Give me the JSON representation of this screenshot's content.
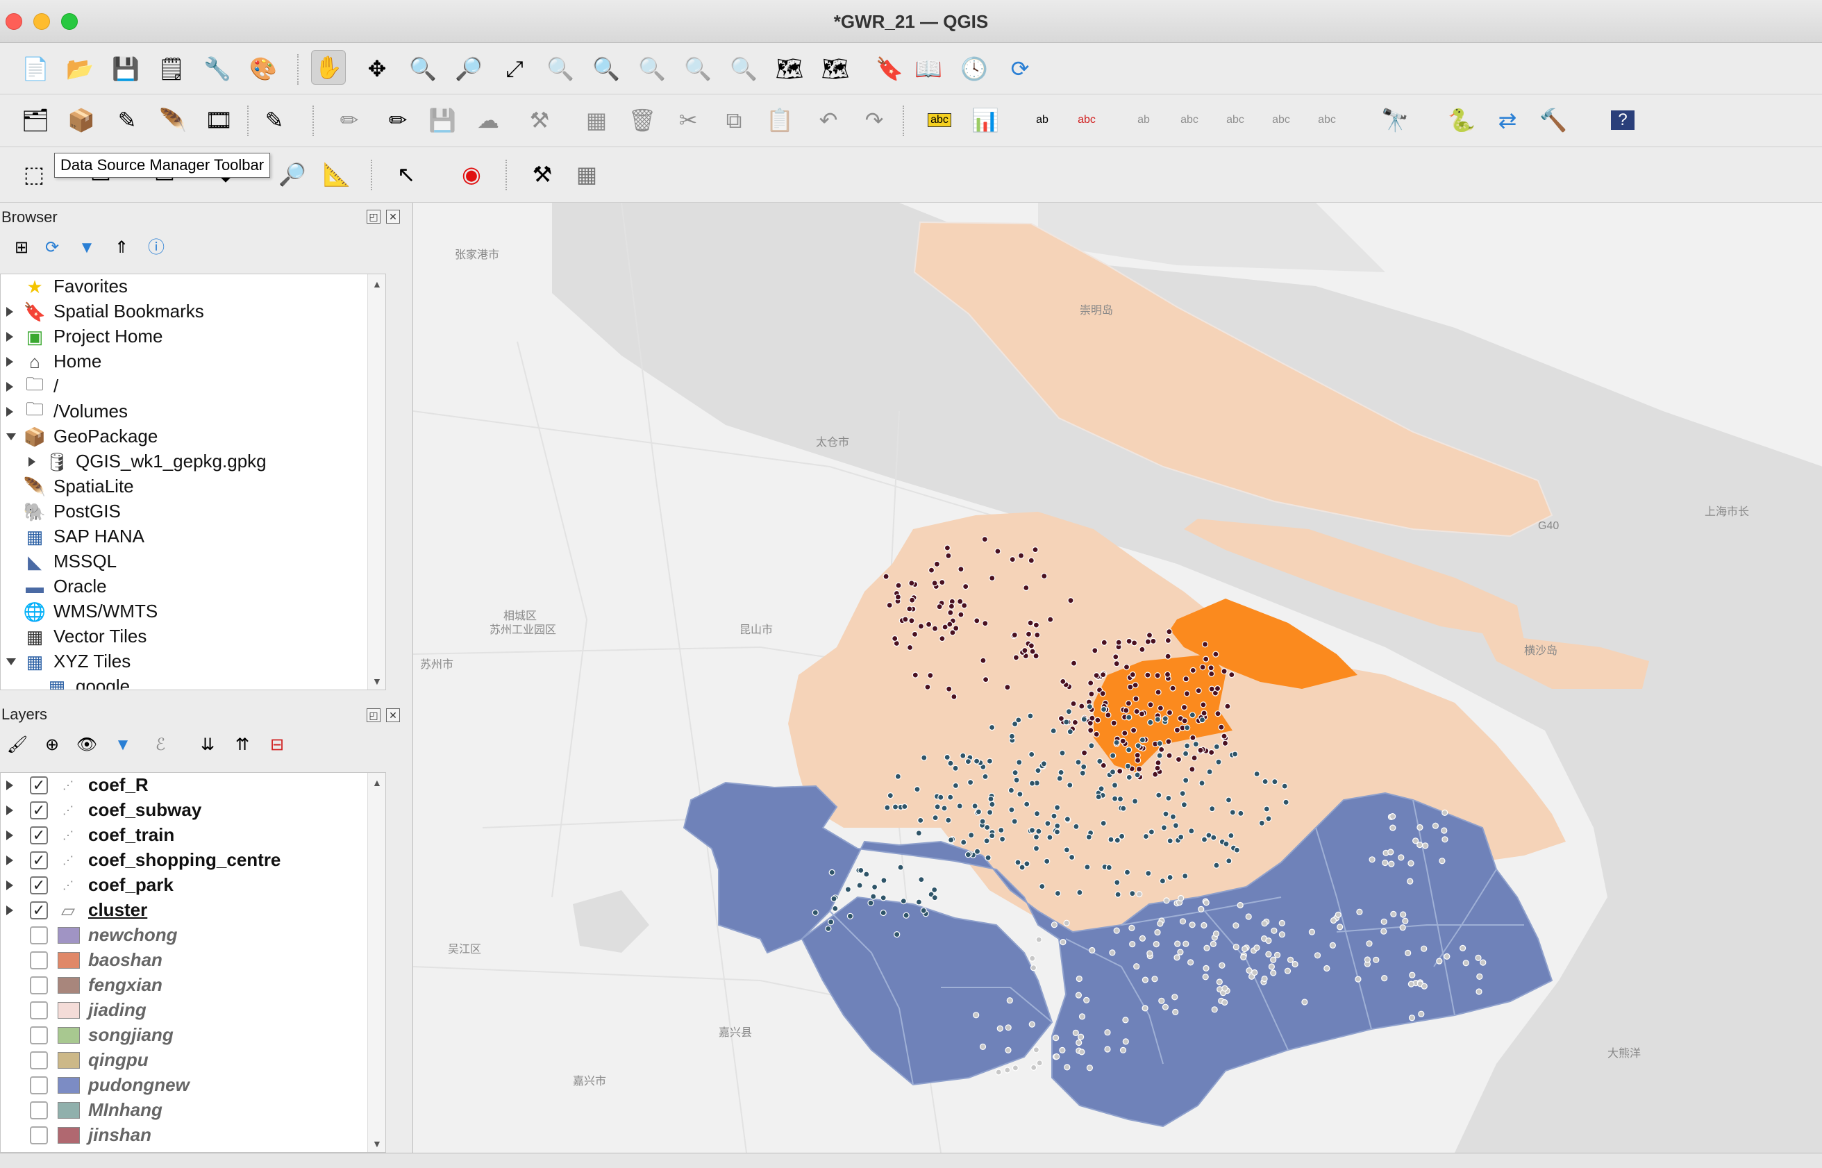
{
  "window": {
    "title": "*GWR_21 — QGIS"
  },
  "tooltip": {
    "text": "Data Source Manager Toolbar"
  },
  "browser": {
    "title": "Browser",
    "items": [
      {
        "label": "Favorites",
        "icon": "star-icon",
        "expand": "none"
      },
      {
        "label": "Spatial Bookmarks",
        "icon": "bookmark-icon",
        "expand": "right"
      },
      {
        "label": "Project Home",
        "icon": "project-home-icon",
        "expand": "right"
      },
      {
        "label": "Home",
        "icon": "home-icon",
        "expand": "right"
      },
      {
        "label": "/",
        "icon": "folder-icon",
        "expand": "right"
      },
      {
        "label": "/Volumes",
        "icon": "folder-icon",
        "expand": "right"
      },
      {
        "label": "GeoPackage",
        "icon": "geopackage-icon",
        "expand": "down"
      },
      {
        "label": "QGIS_wk1_gepkg.gpkg",
        "icon": "database-icon",
        "expand": "right",
        "indent": 1
      },
      {
        "label": "SpatiaLite",
        "icon": "spatialite-icon",
        "expand": "none"
      },
      {
        "label": "PostGIS",
        "icon": "postgis-icon",
        "expand": "none"
      },
      {
        "label": "SAP HANA",
        "icon": "sap-hana-icon",
        "expand": "none"
      },
      {
        "label": "MSSQL",
        "icon": "mssql-icon",
        "expand": "none"
      },
      {
        "label": "Oracle",
        "icon": "oracle-icon",
        "expand": "none"
      },
      {
        "label": "WMS/WMTS",
        "icon": "wms-globe-icon",
        "expand": "none"
      },
      {
        "label": "Vector Tiles",
        "icon": "vector-tiles-icon",
        "expand": "none"
      },
      {
        "label": "XYZ Tiles",
        "icon": "xyz-tiles-icon",
        "expand": "down"
      },
      {
        "label": "google",
        "icon": "xyz-tiles-icon",
        "expand": "none",
        "indent": 1
      }
    ]
  },
  "layers": {
    "title": "Layers",
    "items": [
      {
        "label": "coef_R",
        "checked": true,
        "kind": "points",
        "style": "bold"
      },
      {
        "label": "coef_subway",
        "checked": true,
        "kind": "points",
        "style": "bold"
      },
      {
        "label": "coef_train",
        "checked": true,
        "kind": "points",
        "style": "bold"
      },
      {
        "label": "coef_shopping_centre",
        "checked": true,
        "kind": "points",
        "style": "bold"
      },
      {
        "label": "coef_park",
        "checked": true,
        "kind": "points",
        "style": "bold"
      },
      {
        "label": "cluster",
        "checked": true,
        "kind": "polygon",
        "style": "bold-underline"
      },
      {
        "label": "newchong",
        "checked": false,
        "kind": "swatch",
        "color": "#a094c4",
        "style": "italic"
      },
      {
        "label": "baoshan",
        "checked": false,
        "kind": "swatch",
        "color": "#e08868",
        "style": "italic"
      },
      {
        "label": "fengxian",
        "checked": false,
        "kind": "swatch",
        "color": "#a8867c",
        "style": "italic"
      },
      {
        "label": "jiading",
        "checked": false,
        "kind": "swatch",
        "color": "#f4dcd8",
        "style": "italic"
      },
      {
        "label": "songjiang",
        "checked": false,
        "kind": "swatch",
        "color": "#a8c890",
        "style": "italic"
      },
      {
        "label": "qingpu",
        "checked": false,
        "kind": "swatch",
        "color": "#ccb888",
        "style": "italic"
      },
      {
        "label": "pudongnew",
        "checked": false,
        "kind": "swatch",
        "color": "#7c8cc4",
        "style": "italic"
      },
      {
        "label": "MInhang",
        "checked": false,
        "kind": "swatch",
        "color": "#90b0ac",
        "style": "italic"
      },
      {
        "label": "jinshan",
        "checked": false,
        "kind": "swatch",
        "color": "#b06870",
        "style": "italic"
      }
    ]
  },
  "colors": {
    "peach": "#f5d3b8",
    "orange": "#fb8a1e",
    "blue": "#6f82b9",
    "dark_point": "#4a1020",
    "teal_point": "#2e5468",
    "water": "#dcdcdc",
    "land": "#f1f1f1"
  }
}
